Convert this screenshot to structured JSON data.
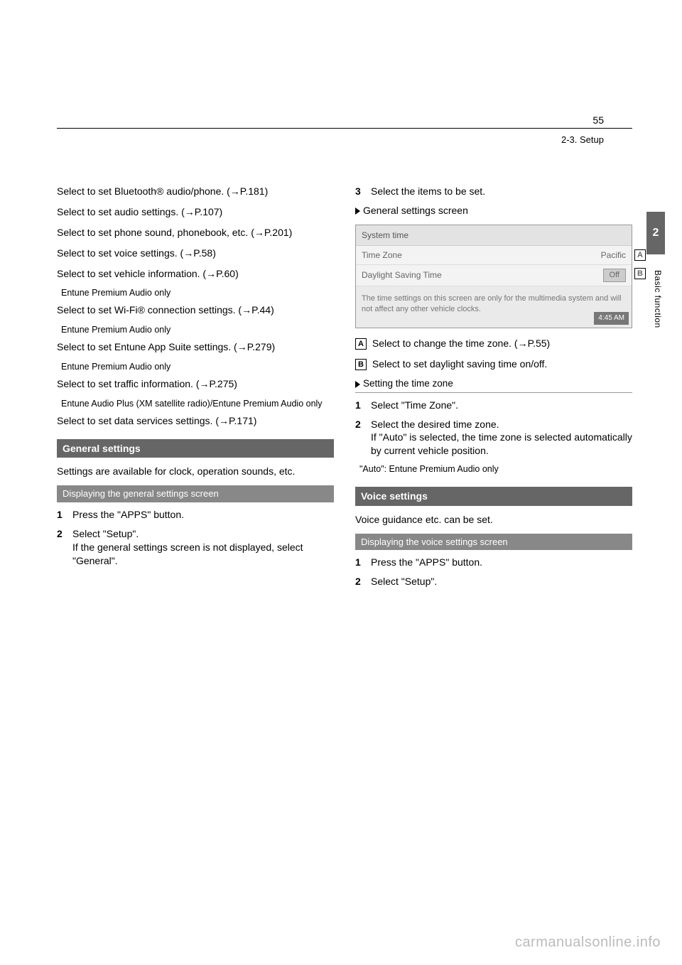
{
  "page_number": "55",
  "section_path": "2-3. Setup",
  "side_tab": "2",
  "vertical_label": "Basic function",
  "left": {
    "bluetooth_line": "Select to set Bluetooth® audio/phone. (→P.181)",
    "audio_line": "Select to set audio settings. (→P.107)",
    "phone_line": "Select to set phone sound, phonebook, etc. (→P.201)",
    "voice_line": "Select to set voice settings. (→P.58)",
    "vehicle_line": "Select to set vehicle information. (→P.60)",
    "wifi_note": "Entune Premium Audio only",
    "wifi_line": "Select to set Wi-Fi® connection settings. (→P.44)",
    "apps_note": "Entune Premium Audio only",
    "apps_line": "Select to set Entune App Suite settings. (→P.279)",
    "traffic_note": "Entune Premium Audio only",
    "traffic_line": "Select to set traffic information. (→P.275)",
    "datasvc_note": "Entune Audio Plus (XM satellite radio)/Entune Premium Audio only",
    "datasvc_line": "Select to set data services settings. (→P.171)",
    "general_head": "General settings",
    "general_para": "Settings are available for clock, operation sounds, etc.",
    "gen_sub": "Displaying the general settings screen",
    "gen_step1": "Press the \"APPS\" button.",
    "gen_step2a": "Select \"Setup\".",
    "gen_step2b": "If the general settings screen is not displayed, select \"General\"."
  },
  "right": {
    "step3": "Select the items to be set.",
    "screen_head": "General settings screen",
    "system_time_screen": {
      "title": "System time",
      "timezone_label": "Time Zone",
      "timezone_value": "Pacific",
      "dst_label": "Daylight Saving Time",
      "dst_value": "Off",
      "note": "The time settings on this screen are only for the multimedia system and will not affect any other vehicle clocks.",
      "clock": "4:45 AM"
    },
    "callout_a": "A",
    "callout_b": "B",
    "desc_a": "Select to change the time zone. (→P.55)",
    "desc_b": "Select to set daylight saving time on/off.",
    "set_tz_head": "Setting the time zone",
    "tz_step1": "Select \"Time Zone\".",
    "tz_step2": "Select the desired time zone.",
    "tz_extra": "If \"Auto\" is selected, the time zone is selected automatically by current vehicle position.",
    "tz_note": "\"Auto\": Entune Premium Audio only",
    "voice_head": "Voice settings",
    "voice_para": "Voice guidance etc. can be set.",
    "voice_sub": "Displaying the voice settings screen",
    "v_step1": "Press the \"APPS\" button.",
    "v_step2": "Select \"Setup\"."
  },
  "watermark": "carmanualsonline.info"
}
